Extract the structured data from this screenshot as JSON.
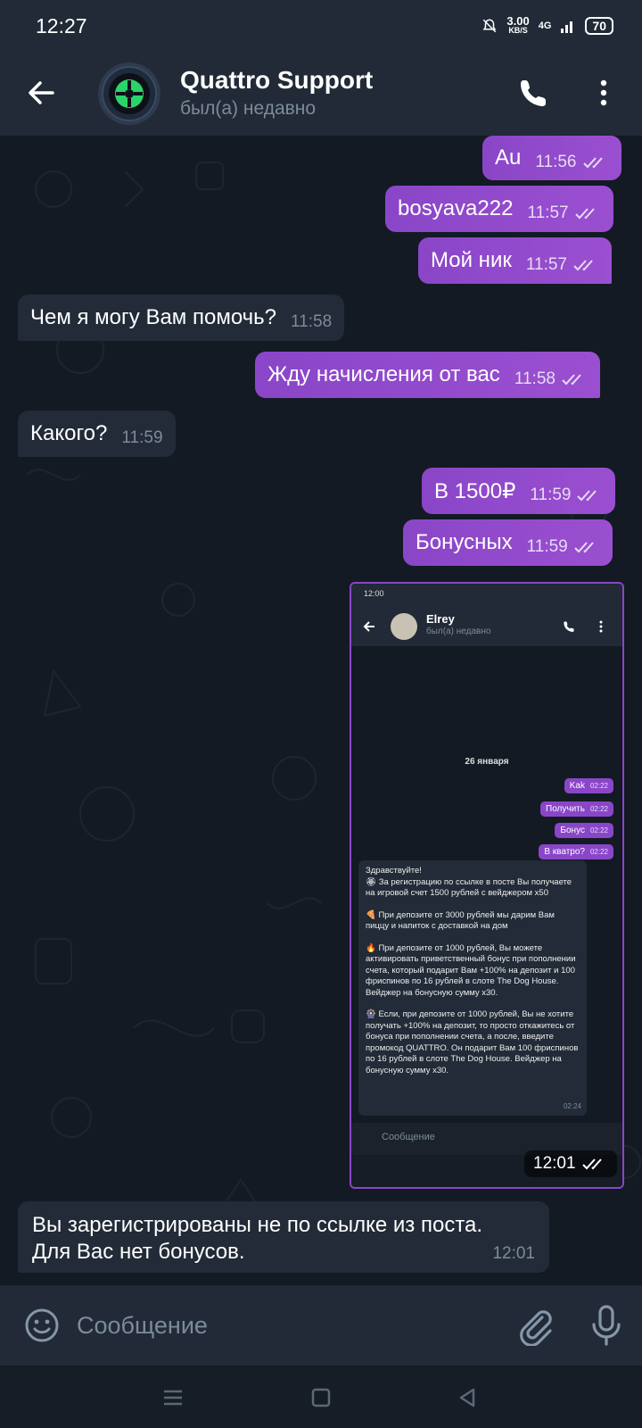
{
  "status_bar": {
    "time": "12:27",
    "speed_value": "3.00",
    "speed_unit": "KB/S",
    "network": "4G",
    "battery": "70"
  },
  "header": {
    "title": "Quattro Support",
    "subtitle": "был(а) недавно"
  },
  "messages": [
    {
      "direction": "out",
      "text": "Au",
      "time": "11:56"
    },
    {
      "direction": "out",
      "text": "bosyava222",
      "time": "11:57"
    },
    {
      "direction": "out",
      "text": "Мой ник",
      "time": "11:57"
    },
    {
      "direction": "in",
      "text": "Чем я могу Вам помочь?",
      "time": "11:58"
    },
    {
      "direction": "out",
      "text": "Жду начисления от вас",
      "time": "11:58"
    },
    {
      "direction": "in",
      "text": "Какого?",
      "time": "11:59"
    },
    {
      "direction": "out",
      "text": "В 1500₽",
      "time": "11:59"
    },
    {
      "direction": "out",
      "text": "Бонусных",
      "time": "11:59"
    },
    {
      "direction": "in",
      "text_line1": "Вы зарегистрированы не по ссылке из поста.",
      "text_line2": "Для Вас нет бонусов.",
      "time": "12:01"
    }
  ],
  "screenshot_message": {
    "time": "12:01",
    "inner": {
      "status_time": "12:00",
      "title": "Elrey",
      "subtitle": "был(а) недавно",
      "date": "26 января",
      "bubbles": [
        {
          "text": "Kak",
          "time": "02:22"
        },
        {
          "text": "Получить",
          "time": "02:22"
        },
        {
          "text": "Бонус",
          "time": "02:22"
        },
        {
          "text": "В кватро?",
          "time": "02:22"
        }
      ],
      "reply": {
        "p1": "Здравствуйте!\n🏵 За регистрацию по ссылке в посте Вы получаете на игровой счет 1500 рублей с вейджером x50",
        "p2": "🍕 При депозите от 3000 рублей мы дарим Вам пиццу и напиток с доставкой на дом",
        "p3": "🔥 При депозите от 1000 рублей, Вы можете активировать приветственный бонус при пополнении счета, который подарит Вам +100% на депозит и 100 фриспинов по 16 рублей в слоте The Dog House. Вейджер на бонусную сумму x30.",
        "p4": "🎡 Если, при депозите от 1000 рублей, Вы не хотите получать +100% на депозит, то просто откажитесь от бонуса при пополнении счета, а после, введите промокод QUATTRO. Он подарит Вам 100 фриспинов по 16 рублей в слоте The Dog House. Вейджер на бонусную сумму x30.",
        "time": "02:24"
      },
      "input_placeholder": "Сообщение"
    }
  },
  "input": {
    "placeholder": "Сообщение"
  },
  "colors": {
    "outgoing_bubble": "#8a46c8",
    "incoming_bubble": "#222b37",
    "header_bg": "#212a36",
    "chat_bg": "#131a23"
  }
}
